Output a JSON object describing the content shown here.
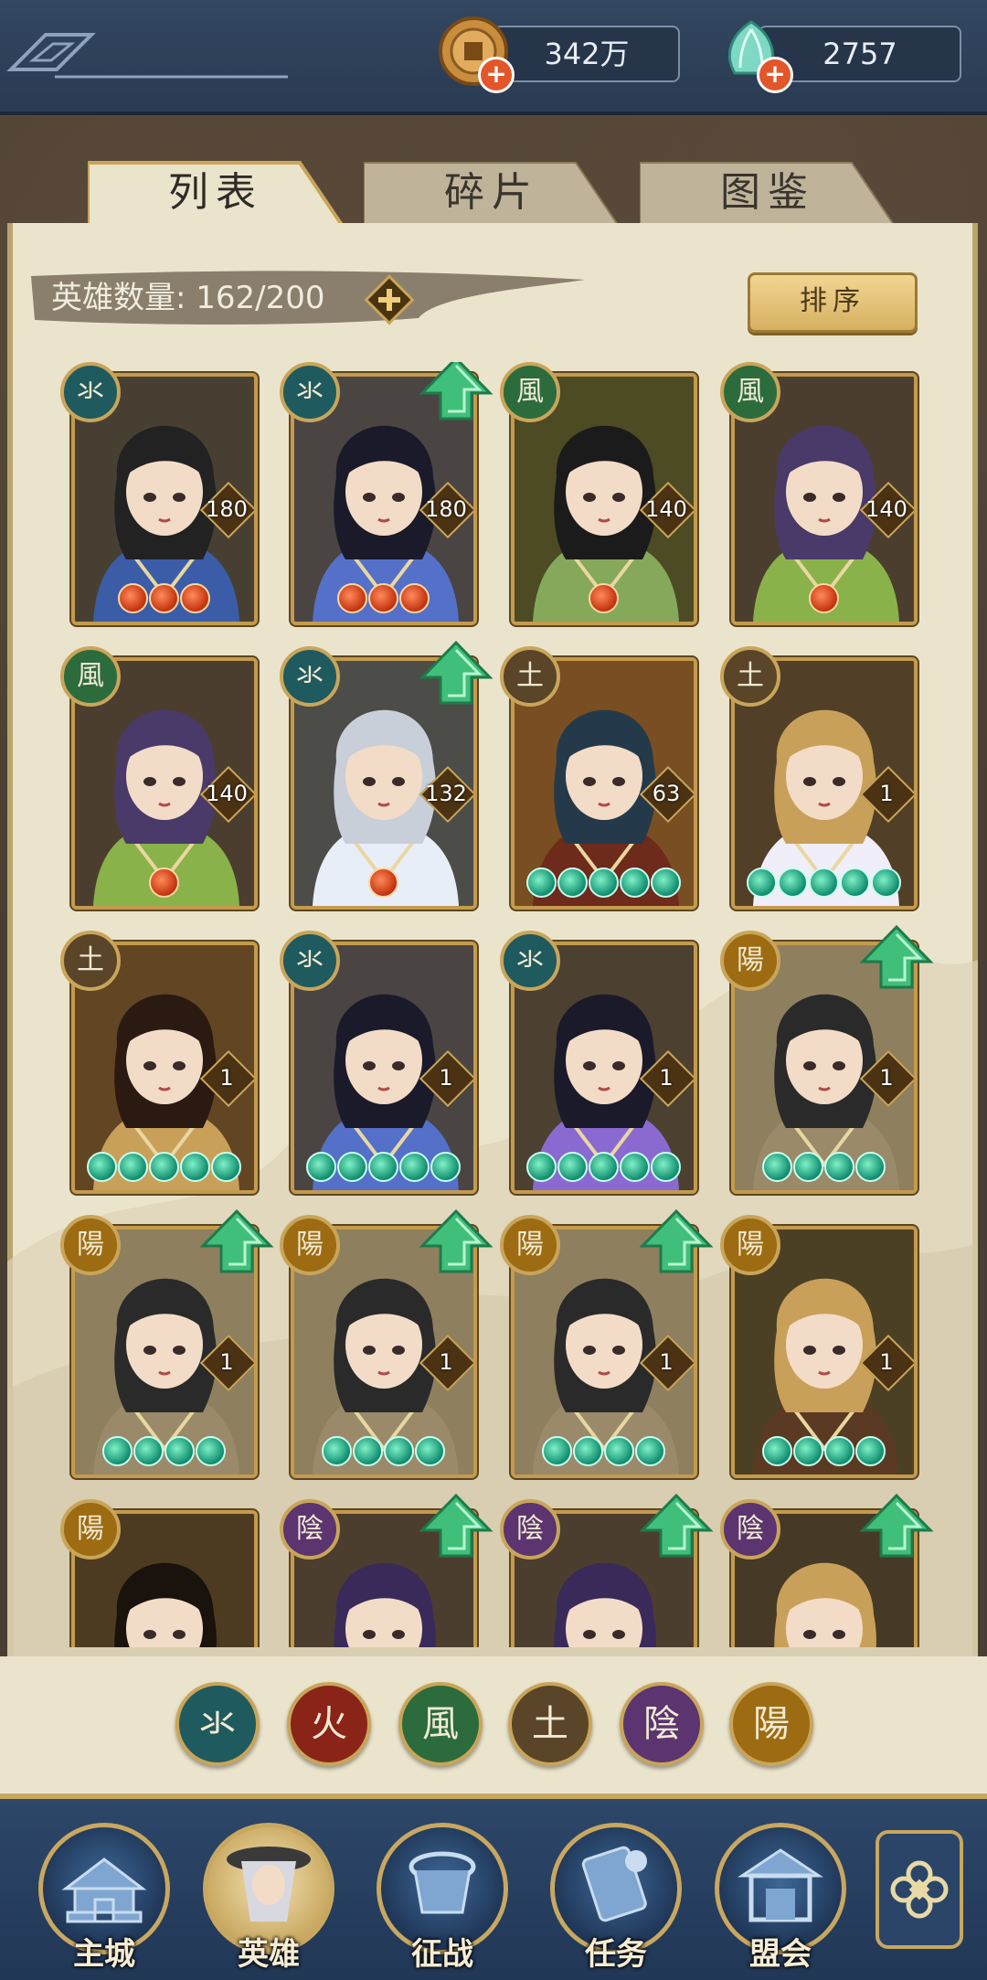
{
  "topbar": {
    "coins": {
      "value": "342万",
      "icon": "copper-coin-icon"
    },
    "gems": {
      "value": "2757",
      "icon": "jade-shell-icon"
    }
  },
  "tabs": [
    {
      "label": "列表",
      "active": true
    },
    {
      "label": "碎片",
      "active": false
    },
    {
      "label": "图鉴",
      "active": false
    }
  ],
  "hero_count": {
    "label": "英雄数量: 162/200"
  },
  "sort_label": "排序",
  "elements": {
    "water": {
      "glyph": "氺",
      "color": "#1f5a5e"
    },
    "fire": {
      "glyph": "火",
      "color": "#8a2418"
    },
    "wind": {
      "glyph": "風",
      "color": "#2c6b3c"
    },
    "earth": {
      "glyph": "土",
      "color": "#5a4529"
    },
    "yin": {
      "glyph": "陰",
      "color": "#5b3470"
    },
    "yang": {
      "glyph": "陽",
      "color": "#9c6b12"
    }
  },
  "heroes": [
    {
      "element": "water",
      "level": "180",
      "stars": 3,
      "star_type": "red",
      "upgrade": false,
      "palette": [
        "#1c2a4a",
        "#3b5da8",
        "#222"
      ]
    },
    {
      "element": "water",
      "level": "180",
      "stars": 3,
      "star_type": "red",
      "upgrade": true,
      "palette": [
        "#243a7a",
        "#5470c8",
        "#1a1a2a"
      ]
    },
    {
      "element": "wind",
      "level": "140",
      "stars": 1,
      "star_type": "red",
      "upgrade": false,
      "palette": [
        "#2d4a22",
        "#86a85a",
        "#1b1b1b"
      ]
    },
    {
      "element": "wind",
      "level": "140",
      "stars": 1,
      "star_type": "red",
      "upgrade": false,
      "palette": [
        "#2b2440",
        "#8ab24a",
        "#4a3a6a"
      ]
    },
    {
      "element": "wind",
      "level": "140",
      "stars": 1,
      "star_type": "red",
      "upgrade": false,
      "palette": [
        "#2b2440",
        "#8ab24a",
        "#4a3a6a"
      ]
    },
    {
      "element": "water",
      "level": "132",
      "stars": 1,
      "star_type": "red",
      "upgrade": true,
      "palette": [
        "#2c4d8a",
        "#e8eef8",
        "#c9cfd8"
      ]
    },
    {
      "element": "earth",
      "level": "63",
      "stars": 5,
      "star_type": "teal",
      "upgrade": false,
      "palette": [
        "#a8541c",
        "#6e2a1a",
        "#243a4a"
      ]
    },
    {
      "element": "earth",
      "level": "1",
      "stars": 5,
      "star_type": "teal",
      "upgrade": false,
      "palette": [
        "#3a2a2a",
        "#f0eef8",
        "#c9a05a"
      ]
    },
    {
      "element": "earth",
      "level": "1",
      "stars": 5,
      "star_type": "teal",
      "upgrade": false,
      "palette": [
        "#6a3a1e",
        "#c9a05a",
        "#2a1a12"
      ]
    },
    {
      "element": "water",
      "level": "1",
      "stars": 5,
      "star_type": "teal",
      "upgrade": false,
      "palette": [
        "#243a7a",
        "#5470c8",
        "#1a1a2a"
      ]
    },
    {
      "element": "water",
      "level": "1",
      "stars": 5,
      "star_type": "teal",
      "upgrade": false,
      "palette": [
        "#2a2a44",
        "#8a6ad0",
        "#1a1a2a"
      ]
    },
    {
      "element": "yang",
      "level": "1",
      "stars": 4,
      "star_type": "teal",
      "upgrade": true,
      "palette": [
        "#e8e2c8",
        "#9a8a6a",
        "#2a2a2a"
      ]
    },
    {
      "element": "yang",
      "level": "1",
      "stars": 4,
      "star_type": "teal",
      "upgrade": true,
      "palette": [
        "#e8e2c8",
        "#9a8a6a",
        "#2a2a2a"
      ]
    },
    {
      "element": "yang",
      "level": "1",
      "stars": 4,
      "star_type": "teal",
      "upgrade": true,
      "palette": [
        "#e8e2c8",
        "#9a8a6a",
        "#2a2a2a"
      ]
    },
    {
      "element": "yang",
      "level": "1",
      "stars": 4,
      "star_type": "teal",
      "upgrade": true,
      "palette": [
        "#e8e2c8",
        "#9a8a6a",
        "#2a2a2a"
      ]
    },
    {
      "element": "yang",
      "level": "1",
      "stars": 4,
      "star_type": "teal",
      "upgrade": false,
      "palette": [
        "#2a2a22",
        "#5a3a22",
        "#c9a05a"
      ]
    },
    {
      "element": "yang",
      "level": "",
      "stars": 0,
      "star_type": "teal",
      "upgrade": false,
      "palette": [
        "#2a1e16",
        "#c9a07a",
        "#1a120c"
      ]
    },
    {
      "element": "yin",
      "level": "",
      "stars": 0,
      "star_type": "teal",
      "upgrade": true,
      "palette": [
        "#2a2440",
        "#d88ad8",
        "#3a2a5a"
      ]
    },
    {
      "element": "yin",
      "level": "",
      "stars": 0,
      "star_type": "teal",
      "upgrade": true,
      "palette": [
        "#2a2440",
        "#d88ad8",
        "#3a2a5a"
      ]
    },
    {
      "element": "yin",
      "level": "",
      "stars": 0,
      "star_type": "teal",
      "upgrade": true,
      "palette": [
        "#1a1a2a",
        "#2a2a44",
        "#c9a05a"
      ]
    }
  ],
  "filters": [
    "water",
    "fire",
    "wind",
    "earth",
    "yin",
    "yang"
  ],
  "nav": [
    {
      "label": "主城",
      "icon": "palace-icon"
    },
    {
      "label": "英雄",
      "icon": "hero-portrait-icon"
    },
    {
      "label": "征战",
      "icon": "battle-drum-icon"
    },
    {
      "label": "任务",
      "icon": "scroll-quest-icon"
    },
    {
      "label": "盟会",
      "icon": "pavilion-icon"
    }
  ],
  "more_icon": "menu-ornament-icon"
}
